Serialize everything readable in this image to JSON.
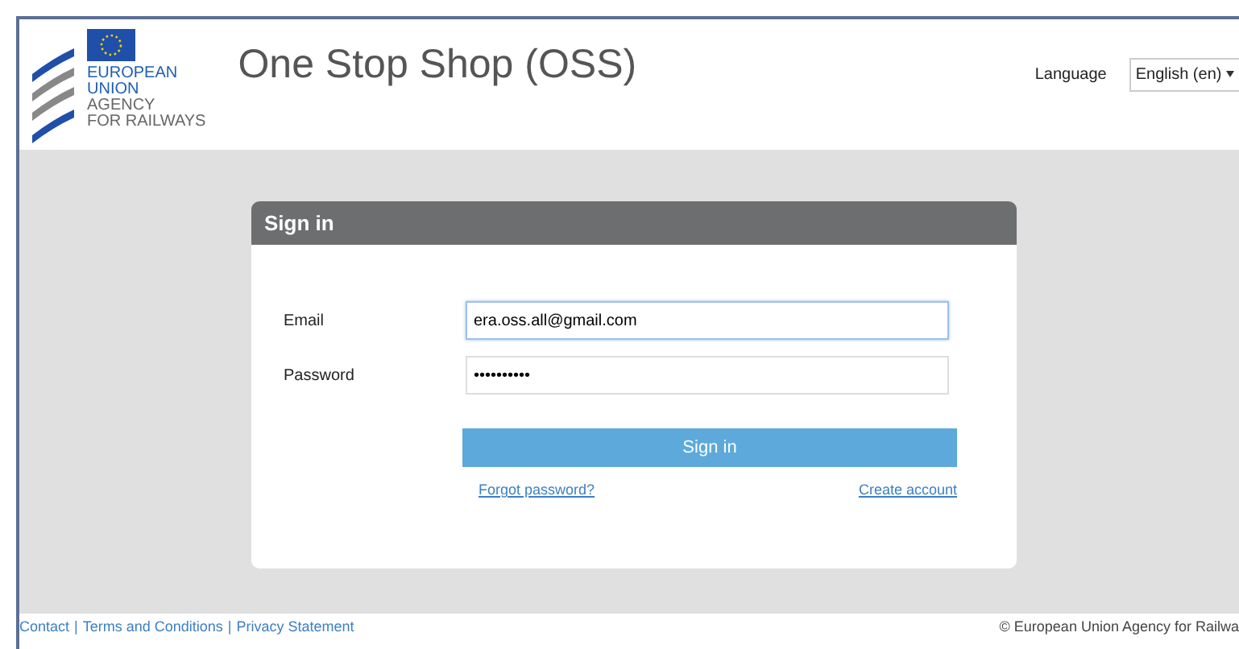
{
  "header": {
    "logo_lines": [
      "EUROPEAN",
      "UNION",
      "AGENCY",
      "FOR RAILWAYS"
    ],
    "title": "One Stop Shop (OSS)",
    "language_label": "Language",
    "language_value": "English (en)"
  },
  "signin": {
    "title": "Sign in",
    "fields": [
      {
        "label": "Email",
        "value": "era.oss.all@gmail.com",
        "focused": true
      },
      {
        "label": "Password",
        "value": "••••••••••",
        "focused": false
      }
    ],
    "button": "Sign in",
    "links": [
      "Forgot password?",
      "Create account"
    ]
  },
  "footer": {
    "links": [
      "Contact",
      "Terms and Conditions",
      "Privacy Statement"
    ],
    "separator": "|",
    "copyright": "© European Union Agency for Railwa"
  }
}
